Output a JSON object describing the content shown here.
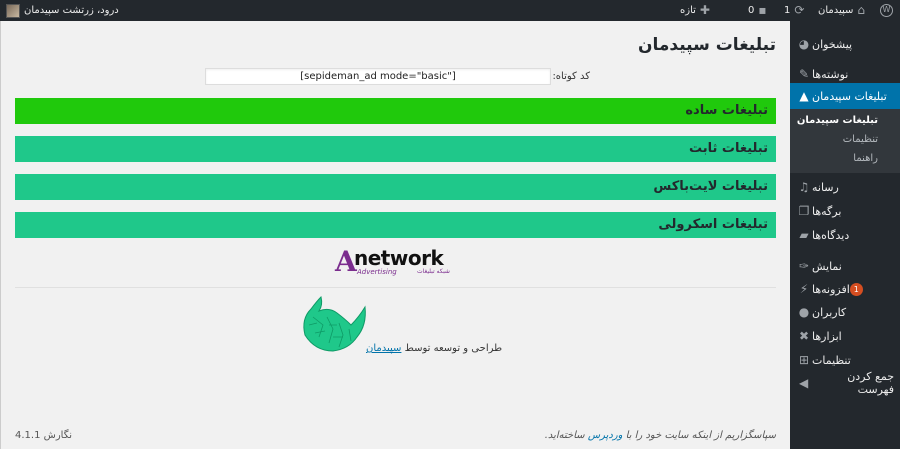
{
  "adminbar": {
    "site_name": "سپیدمان",
    "updates_count": "1",
    "comments_count": "0",
    "new_label": "تازه",
    "howdy": "درود، زرتشت سپیدمان"
  },
  "sidebar": {
    "items": [
      {
        "label": "پیشخوان",
        "icon": "dashboard-icon"
      },
      {
        "label": "نوشته‌ها",
        "icon": "pin-icon"
      },
      {
        "label": "تبلیغات سپیدمان",
        "icon": "sepideman-ads-icon"
      },
      {
        "label": "رسانه",
        "icon": "media-icon"
      },
      {
        "label": "برگه‌ها",
        "icon": "pages-icon"
      },
      {
        "label": "دیدگاه‌ها",
        "icon": "comments-icon"
      },
      {
        "label": "نمایش",
        "icon": "appearance-icon"
      },
      {
        "label": "افزونه‌ها",
        "icon": "plugins-icon",
        "badge": "1"
      },
      {
        "label": "کاربران",
        "icon": "users-icon"
      },
      {
        "label": "ابزارها",
        "icon": "tools-icon"
      },
      {
        "label": "تنظیمات",
        "icon": "settings-icon"
      },
      {
        "label": "جمع کردن فهرست",
        "icon": "collapse-icon"
      }
    ],
    "submenu": [
      {
        "label": "تبلیغات سپیدمان"
      },
      {
        "label": "تنظیمات"
      },
      {
        "label": "راهنما"
      }
    ]
  },
  "main": {
    "title": "تبلیغات سپیدمان",
    "shortcode_label": "کد کوتاه:",
    "shortcode_value": "[sepideman_ad mode=\"basic\"]",
    "bars": {
      "simple": "تبلیغات ساده",
      "fixed": "تبلیغات ثابت",
      "lightbox": "تبلیغات لایت‌باکس",
      "scroll": "تبلیغات اسکرولی"
    },
    "network_logo": {
      "letter": "A",
      "word": "network",
      "sub": "Advertising",
      "sub_fa": "شبکه تبلیغات"
    },
    "credit": {
      "text": "طراحی و توسعه توسط",
      "link": "سپیدمان"
    }
  },
  "footer": {
    "thanks_prefix": "سپاسگزاریم از اینکه سایت خود را با",
    "thanks_link": "وردپرس",
    "thanks_suffix": "ساخته‌اید.",
    "version_label": "نگارش 4.1.1"
  },
  "colors": {
    "adminbar_bg": "#23282d",
    "current_menu": "#0073aa",
    "bar_simple": "#20c90c",
    "bar_other": "#1fc88a",
    "badge": "#d54e21"
  }
}
